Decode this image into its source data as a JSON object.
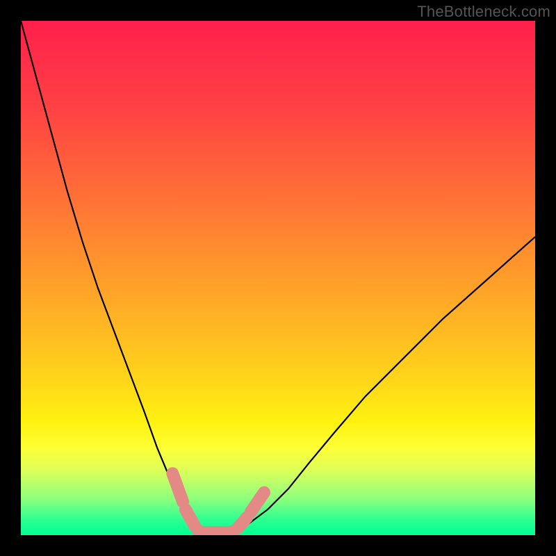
{
  "watermark": "TheBottleneck.com",
  "colors": {
    "frame": "#000000",
    "gradient_top": "#ff1f4b",
    "gradient_bottom": "#00ff94",
    "curve": "#000000",
    "marker": "#e38a86"
  },
  "chart_data": {
    "type": "line",
    "title": "",
    "xlabel": "",
    "ylabel": "",
    "xlim": [
      0,
      100
    ],
    "ylim": [
      0,
      100
    ],
    "background_gradient": "vertical rainbow red→green (bottleneck heat)",
    "series": [
      {
        "name": "left-curve",
        "x": [
          0,
          3,
          6,
          9,
          12,
          15,
          18,
          21,
          24,
          26.5,
          29,
          31,
          33,
          35
        ],
        "y": [
          100,
          89,
          78,
          67,
          57,
          48,
          40,
          32,
          24,
          17,
          11,
          6,
          2.5,
          0.5
        ]
      },
      {
        "name": "right-curve",
        "x": [
          41,
          44,
          48,
          52,
          56,
          61,
          67,
          74,
          82,
          91,
          100
        ],
        "y": [
          0.5,
          2,
          5,
          9,
          14,
          20,
          27,
          34,
          42,
          50,
          58
        ]
      }
    ],
    "markers": [
      {
        "name": "left-segment-top",
        "x0": 29.5,
        "y0": 12.0,
        "x1": 31.5,
        "y1": 6.5
      },
      {
        "name": "left-segment-mid",
        "x0": 32.0,
        "y0": 5.0,
        "x1": 33.8,
        "y1": 1.8
      },
      {
        "name": "left-dot",
        "x": 34.5,
        "y": 0.9
      },
      {
        "name": "bottom-segment",
        "x0": 35.5,
        "y0": 0.55,
        "x1": 40.5,
        "y1": 0.55
      },
      {
        "name": "right-dot",
        "x": 41.5,
        "y": 0.9
      },
      {
        "name": "right-segment-low",
        "x0": 42.3,
        "y0": 1.5,
        "x1": 44.0,
        "y1": 3.5
      },
      {
        "name": "right-segment-high",
        "x0": 44.7,
        "y0": 4.5,
        "x1": 47.3,
        "y1": 8.3
      }
    ]
  }
}
